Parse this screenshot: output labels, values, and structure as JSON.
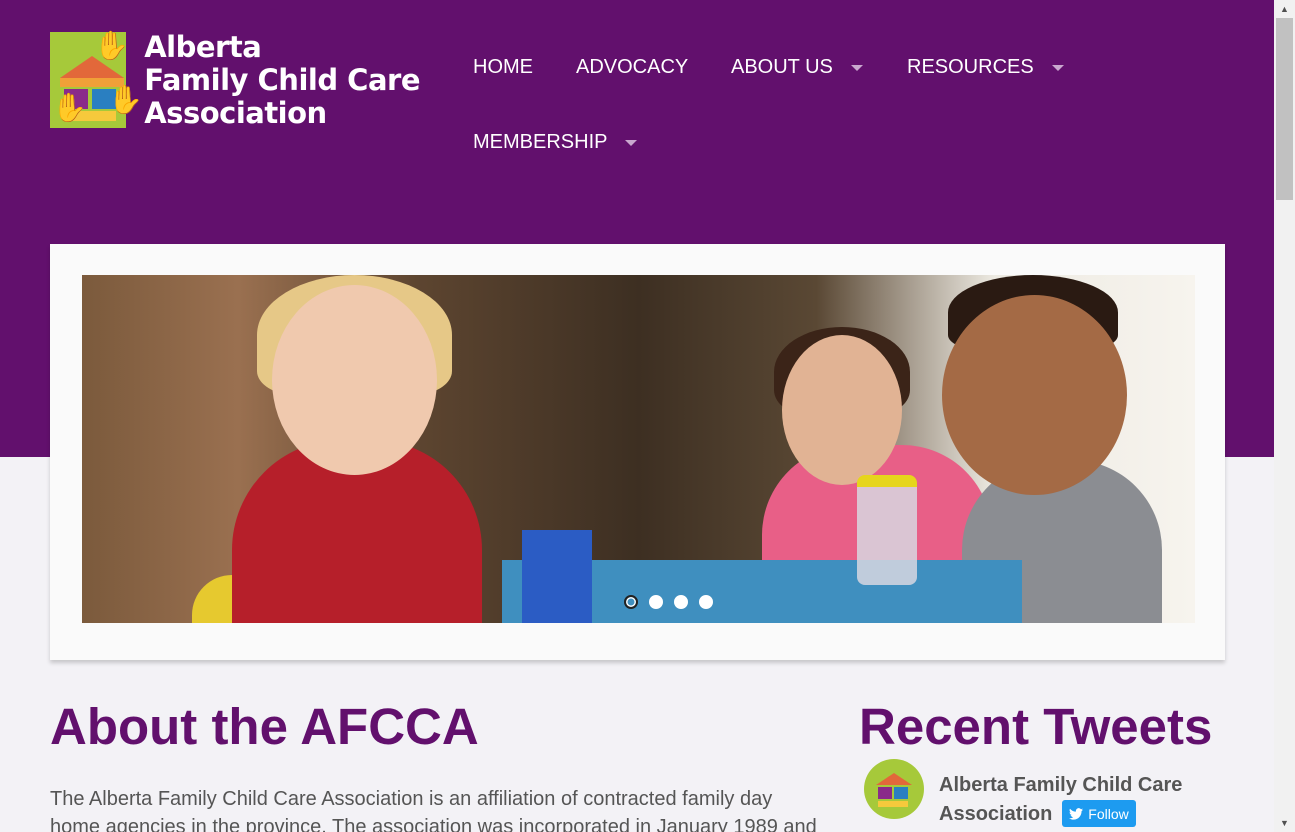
{
  "logo": {
    "line1": "Alberta",
    "line2": "Family Child Care",
    "line3": "Association"
  },
  "nav": {
    "home": "HOME",
    "advocacy": "ADVOCACY",
    "about_us": "ABOUT US",
    "resources": "RESOURCES",
    "membership": "MEMBERSHIP"
  },
  "slider": {
    "dot_count": 4,
    "active_dot": 1
  },
  "about": {
    "title": "About the AFCCA",
    "text_line1": "The Alberta Family Child Care Association is an affiliation of contracted family day",
    "text_line2": "home agencies in the province. The association was incorporated in January 1989 and"
  },
  "tweets": {
    "title": "Recent Tweets",
    "account_line1": "Alberta Family Child Care",
    "account_line2": "Association",
    "follow_label": "Follow"
  },
  "colors": {
    "brand_purple": "#62106d",
    "twitter_blue": "#1d9bf0"
  }
}
